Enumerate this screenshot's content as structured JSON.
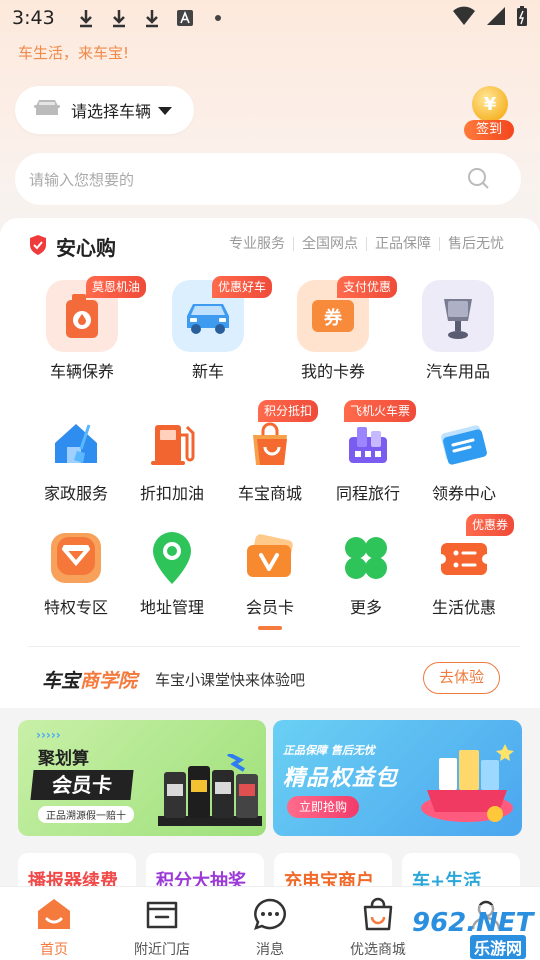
{
  "status_bar": {
    "time": "3:43"
  },
  "slogan": "车生活，来车宝!",
  "car_selector": {
    "label": "请选择车辆"
  },
  "signin": {
    "label": "签到"
  },
  "search": {
    "placeholder": "请输入您想要的"
  },
  "section": {
    "title": "安心购",
    "features": [
      "专业服务",
      "全国网点",
      "正品保障",
      "售后无忧"
    ]
  },
  "grid": {
    "row1": [
      {
        "label": "车辆保养",
        "badge": "莫恩机油"
      },
      {
        "label": "新车",
        "badge": "优惠好车"
      },
      {
        "label": "我的卡券",
        "badge": "支付优惠"
      },
      {
        "label": "汽车用品",
        "badge": ""
      }
    ],
    "row2": [
      {
        "label": "家政服务",
        "badge": ""
      },
      {
        "label": "折扣加油",
        "badge": ""
      },
      {
        "label": "车宝商城",
        "badge": "积分抵扣"
      },
      {
        "label": "同程旅行",
        "badge": "飞机火车票"
      },
      {
        "label": "领券中心",
        "badge": ""
      }
    ],
    "row3": [
      {
        "label": "特权专区",
        "badge": ""
      },
      {
        "label": "地址管理",
        "badge": ""
      },
      {
        "label": "会员卡",
        "badge": ""
      },
      {
        "label": "更多",
        "badge": ""
      },
      {
        "label": "生活优惠",
        "badge": "优惠券"
      }
    ]
  },
  "academy": {
    "logo_a": "车宝",
    "logo_b": "商学院",
    "text": "车宝小课堂快来体验吧",
    "button": "去体验"
  },
  "banners": {
    "left": {
      "line1": "聚划算",
      "line2": "会员卡",
      "line3": "正品溯源假一赔十"
    },
    "right": {
      "line1": "正品保障  售后无忧",
      "line2": "精品权益包",
      "button": "立即抢购"
    }
  },
  "tiles": [
    "播报器续费",
    "积分大抽奖",
    "充电宝商户",
    "车+生活"
  ],
  "tabbar": [
    {
      "label": "首页"
    },
    {
      "label": "附近门店"
    },
    {
      "label": "消息"
    },
    {
      "label": "优选商城"
    },
    {
      "label": ""
    }
  ],
  "watermark": {
    "top": "962.NET",
    "bottom": "乐游网"
  },
  "colors": {
    "accent": "#f47a3d",
    "badge": "#ef4b39"
  }
}
